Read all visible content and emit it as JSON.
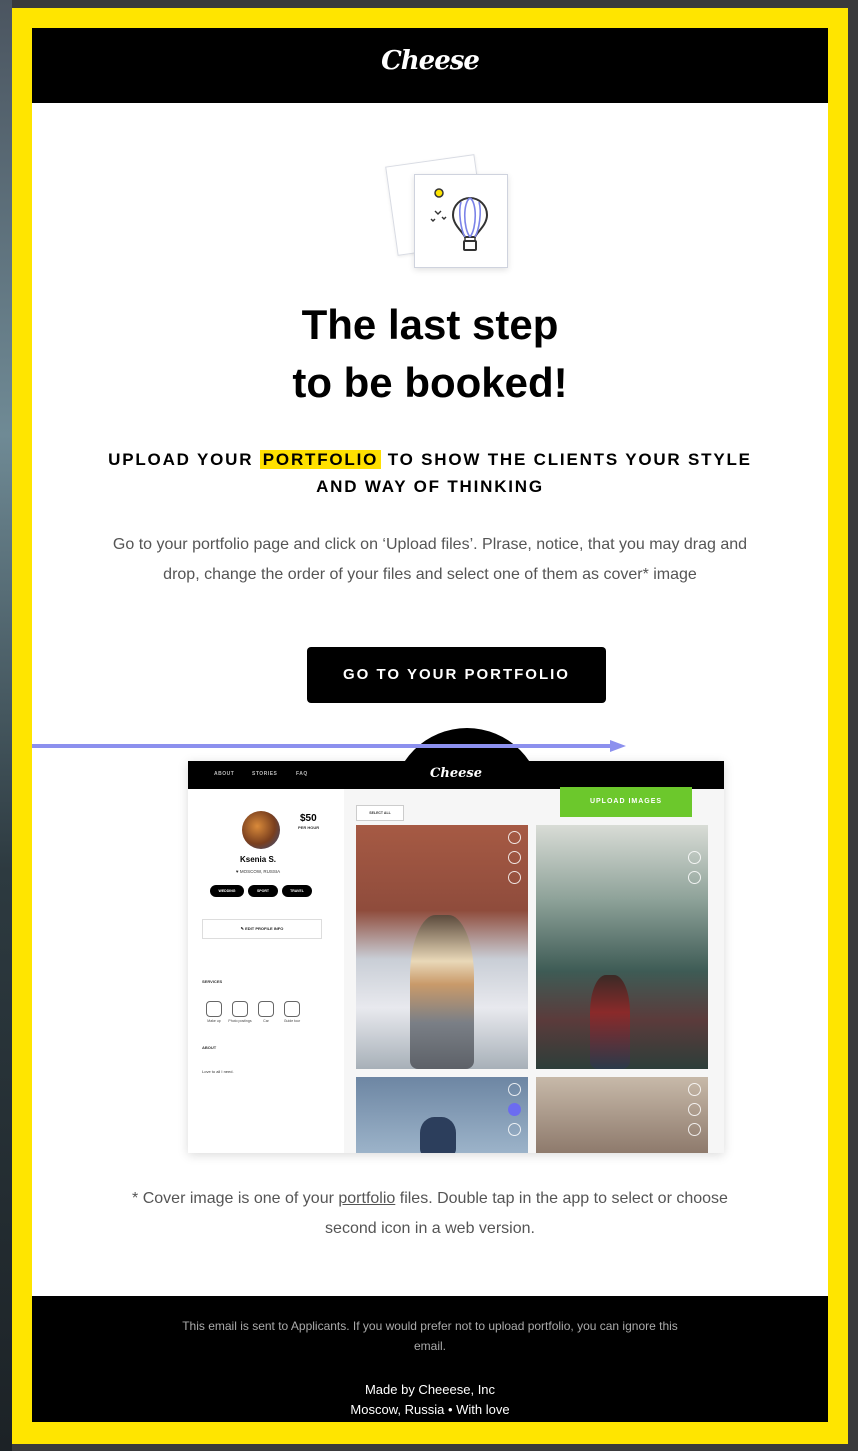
{
  "brand": {
    "logo_text": "Cheese",
    "accent": "#ffe500",
    "button_color": "#000000",
    "upload_color": "#6cc82c"
  },
  "hero": {
    "illustration": "hot-air-balloon-icon",
    "title_line1": "The last step",
    "title_line2": "to be booked!"
  },
  "subhead": {
    "before": "UPLOAD YOUR",
    "highlight": "PORTFOLIO",
    "after": "TO SHOW THE CLIENTS YOUR STYLE AND WAY OF THINKING"
  },
  "body_text": "Go to your portfolio page and click on ‘Upload files’. Plrase, notice, that you may drag and drop, change the order of your files and select one of them as cover* image",
  "cta_label": "GO TO YOUR PORTFOLIO",
  "screenshot": {
    "nav": [
      "ABOUT",
      "STORIES",
      "FAQ"
    ],
    "logo": "Cheese",
    "profile": {
      "price": "$50",
      "price_unit": "PER HOUR",
      "name": "Ksenia S.",
      "location": "♥ MOSCOW, RUSSIA",
      "tags": [
        "WEDDING",
        "SPORT",
        "TRAVEL"
      ],
      "edit_label": "✎ EDIT PROFILE INFO",
      "services_label": "SERVICES",
      "services": [
        "Make up",
        "Photo postings",
        "Car",
        "Guide tour"
      ],
      "about_label": "ABOUT",
      "about_text": "Love to all I need."
    },
    "select_all": "SELECT ALL",
    "upload_label": "UPLOAD IMAGES"
  },
  "footnote": {
    "before": "* Cover image is one of your ",
    "link": "portfolio",
    "after": " files. Double tap in the app to select or choose second icon in a web version."
  },
  "footer": {
    "notice": "This email is sent to Applicants. If you would prefer not to upload portfolio, you can ignore this email.",
    "made_by": "Made by Cheeese, Inc",
    "location_line": "Moscow, Russia  •  With love"
  }
}
